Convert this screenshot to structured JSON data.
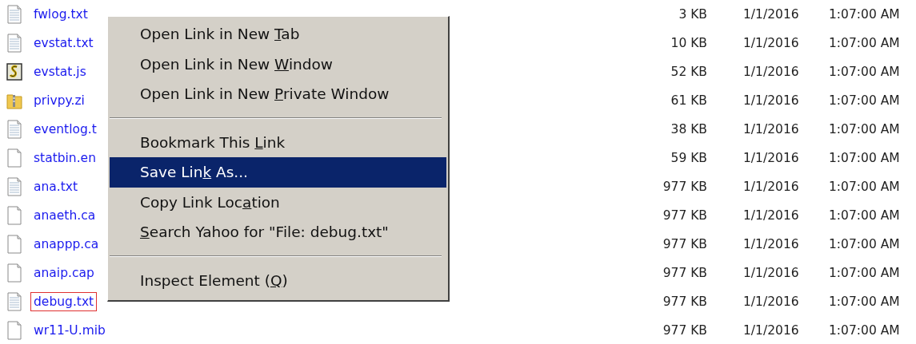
{
  "files": [
    {
      "kind": "text",
      "name": "fwlog.txt",
      "size": "3 KB",
      "date": "1/1/2016",
      "time": "1:07:00 AM",
      "focused": false
    },
    {
      "kind": "text",
      "name": "evstat.txt",
      "size": "10 KB",
      "date": "1/1/2016",
      "time": "1:07:00 AM",
      "focused": false
    },
    {
      "kind": "script",
      "name": "evstat.js",
      "size": "52 KB",
      "date": "1/1/2016",
      "time": "1:07:00 AM",
      "focused": false
    },
    {
      "kind": "zip",
      "name": "privpy.zi",
      "size": "61 KB",
      "date": "1/1/2016",
      "time": "1:07:00 AM",
      "focused": false
    },
    {
      "kind": "text",
      "name": "eventlog.t",
      "size": "38 KB",
      "date": "1/1/2016",
      "time": "1:07:00 AM",
      "focused": false
    },
    {
      "kind": "blank",
      "name": "statbin.en",
      "size": "59 KB",
      "date": "1/1/2016",
      "time": "1:07:00 AM",
      "focused": false
    },
    {
      "kind": "text",
      "name": "ana.txt",
      "size": "977 KB",
      "date": "1/1/2016",
      "time": "1:07:00 AM",
      "focused": false
    },
    {
      "kind": "blank",
      "name": "anaeth.ca",
      "size": "977 KB",
      "date": "1/1/2016",
      "time": "1:07:00 AM",
      "focused": false
    },
    {
      "kind": "blank",
      "name": "anappp.ca",
      "size": "977 KB",
      "date": "1/1/2016",
      "time": "1:07:00 AM",
      "focused": false
    },
    {
      "kind": "blank",
      "name": "anaip.cap",
      "size": "977 KB",
      "date": "1/1/2016",
      "time": "1:07:00 AM",
      "focused": false
    },
    {
      "kind": "text",
      "name": "debug.txt",
      "size": "977 KB",
      "date": "1/1/2016",
      "time": "1:07:00 AM",
      "focused": true
    },
    {
      "kind": "blank",
      "name": "wr11-U.mib",
      "size": "977 KB",
      "date": "1/1/2016",
      "time": "1:07:00 AM",
      "focused": false
    }
  ],
  "context_menu": [
    {
      "kind": "item",
      "before": "Open Link in New ",
      "key": "T",
      "after": "ab",
      "selected": false
    },
    {
      "kind": "item",
      "before": "Open Link in New ",
      "key": "W",
      "after": "indow",
      "selected": false
    },
    {
      "kind": "item",
      "before": "Open Link in New ",
      "key": "P",
      "after": "rivate Window",
      "selected": false
    },
    {
      "kind": "separator"
    },
    {
      "kind": "item",
      "before": "Bookmark This ",
      "key": "L",
      "after": "ink",
      "selected": false
    },
    {
      "kind": "item",
      "before": "Save Lin",
      "key": "k",
      "after": " As...",
      "selected": true
    },
    {
      "kind": "item",
      "before": "Copy Link Loc",
      "key": "a",
      "after": "tion",
      "selected": false
    },
    {
      "kind": "item",
      "key": "S",
      "after": "earch Yahoo for \"File: debug.txt\"",
      "selected": false
    },
    {
      "kind": "separator"
    },
    {
      "kind": "item",
      "before": "Inspect Element (",
      "key": "Q",
      "after": ")",
      "selected": false
    }
  ]
}
